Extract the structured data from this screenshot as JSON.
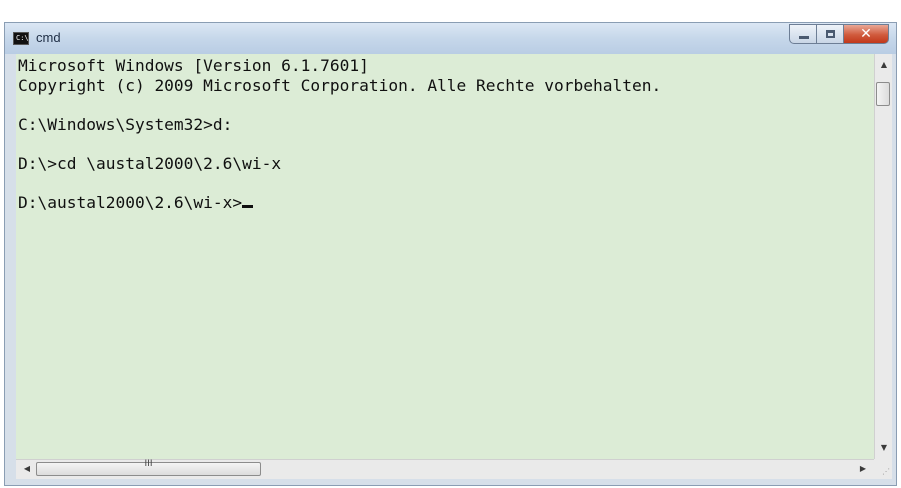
{
  "window": {
    "title": "cmd",
    "icon": "console-icon",
    "icon_text": "C:\\"
  },
  "caption_buttons": {
    "minimize": "minimize-icon",
    "maximize": "maximize-icon",
    "close_glyph": "✕"
  },
  "console": {
    "lines": [
      "Microsoft Windows [Version 6.1.7601]",
      "Copyright (c) 2009 Microsoft Corporation. Alle Rechte vorbehalten.",
      "",
      "C:\\Windows\\System32>d:",
      "",
      "D:\\>cd \\austal2000\\2.6\\wi-x",
      "",
      "D:\\austal2000\\2.6\\wi-x>"
    ],
    "background": "#dcecd6",
    "text_color": "#101010"
  },
  "scrollbars": {
    "up_arrow": "▲",
    "down_arrow": "▼",
    "left_arrow": "◀",
    "right_arrow": "▶",
    "thumb_grip": "III"
  },
  "colors": {
    "close_button": "#c1381b",
    "title_text": "#1e2d44"
  }
}
